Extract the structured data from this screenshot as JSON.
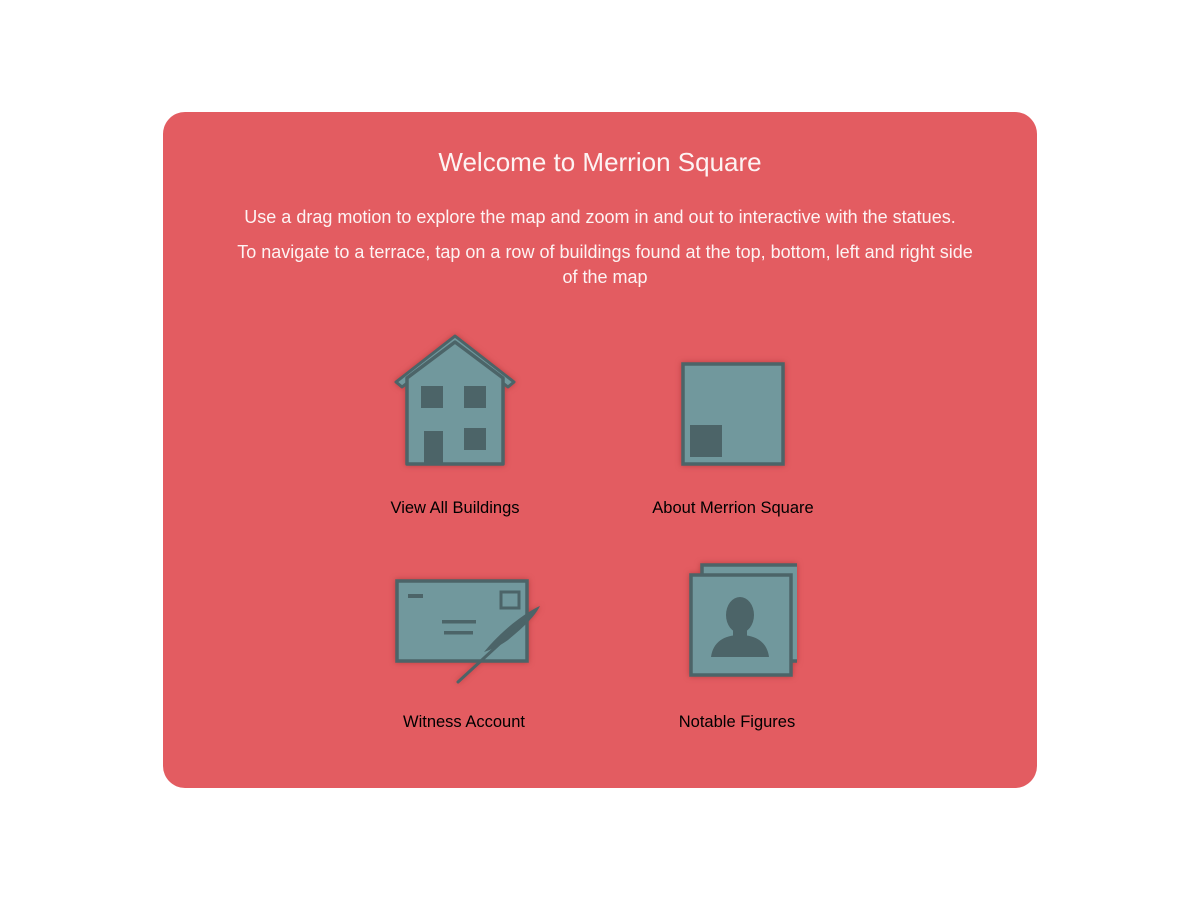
{
  "colors": {
    "card_background": "#e35c61",
    "icon_fill": "#71989d",
    "icon_stroke": "#4c6468",
    "text": "#fdf3f3"
  },
  "welcome": {
    "title": "Welcome to Merrion Square",
    "instruction_1": "Use a drag motion to explore the map and zoom in and out to interactive with the statues.",
    "instruction_2": "To navigate to a terrace, tap on a row of buildings found at the top, bottom, left and right side of the map"
  },
  "menu": {
    "items": [
      {
        "label": "View All Buildings",
        "icon": "house-icon"
      },
      {
        "label": "About Merrion Square",
        "icon": "square-map-icon"
      },
      {
        "label": "Witness Account",
        "icon": "letter-quill-icon"
      },
      {
        "label": "Notable Figures",
        "icon": "portrait-cards-icon"
      }
    ]
  }
}
